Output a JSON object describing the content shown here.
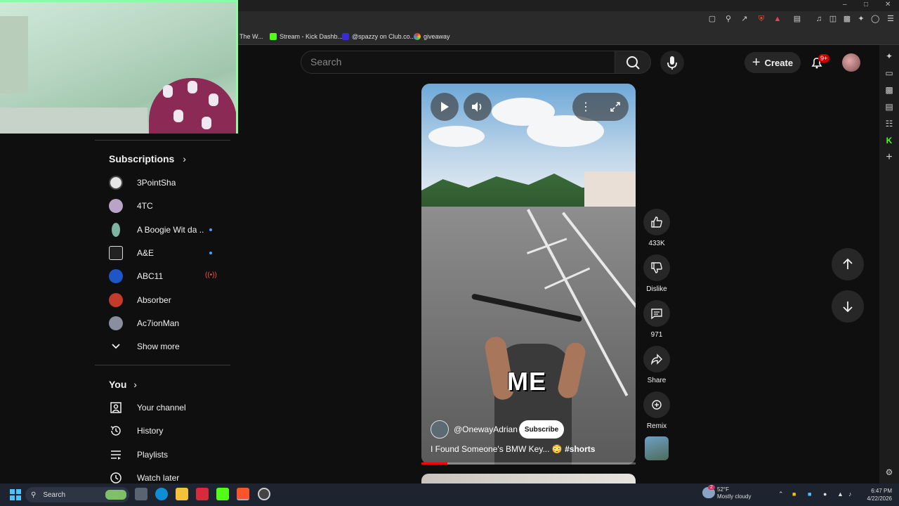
{
  "bookmarks": [
    {
      "label": "The W...",
      "color": "#444"
    },
    {
      "label": "Stream - Kick Dashb...",
      "color": "#53fc18"
    },
    {
      "label": "@spazzy on Club.co...",
      "color": "#3a2bd6"
    },
    {
      "label": "giveaway",
      "color": "#e23a2b"
    }
  ],
  "header": {
    "search_placeholder": "Search",
    "create_label": "Create",
    "notifications_badge": "9+"
  },
  "sidebar": {
    "subscriptions_title": "Subscriptions",
    "subscriptions": [
      {
        "name": "3PointSha",
        "color": "#ddd",
        "indicator": ""
      },
      {
        "name": "4TC",
        "color": "#b9a3c7",
        "indicator": ""
      },
      {
        "name": "A Boogie Wit da ...",
        "color": "#7fb3a1",
        "indicator": "new"
      },
      {
        "name": "A&E",
        "color": "#222",
        "indicator": "new"
      },
      {
        "name": "ABC11",
        "color": "#1e56c8",
        "indicator": "live"
      },
      {
        "name": "Absorber",
        "color": "#c23b2b",
        "indicator": ""
      },
      {
        "name": "Ac7ionMan",
        "color": "#8a8fa0",
        "indicator": ""
      }
    ],
    "show_more": "Show more",
    "you_title": "You",
    "you_items": [
      {
        "label": "Your channel",
        "icon": "person-icon"
      },
      {
        "label": "History",
        "icon": "history-icon"
      },
      {
        "label": "Playlists",
        "icon": "playlist-icon"
      },
      {
        "label": "Watch later",
        "icon": "clock-icon"
      }
    ]
  },
  "short": {
    "overlay_text": "ME",
    "channel": "@OnewayAdrian",
    "subscribe_label": "Subscribe",
    "title": "I Found Someone's BMW Key... 😳 ",
    "hashtag": "#shorts",
    "progress": 0.12
  },
  "actions": {
    "likes": "433K",
    "dislike_label": "Dislike",
    "comments": "971",
    "share_label": "Share",
    "remix_label": "Remix"
  },
  "taskbar": {
    "search_label": "Search",
    "weather_temp": "52°F",
    "weather_desc": "Mostly cloudy",
    "weather_badge": "2",
    "time": "6:47 PM",
    "date": "4/22/2026"
  }
}
